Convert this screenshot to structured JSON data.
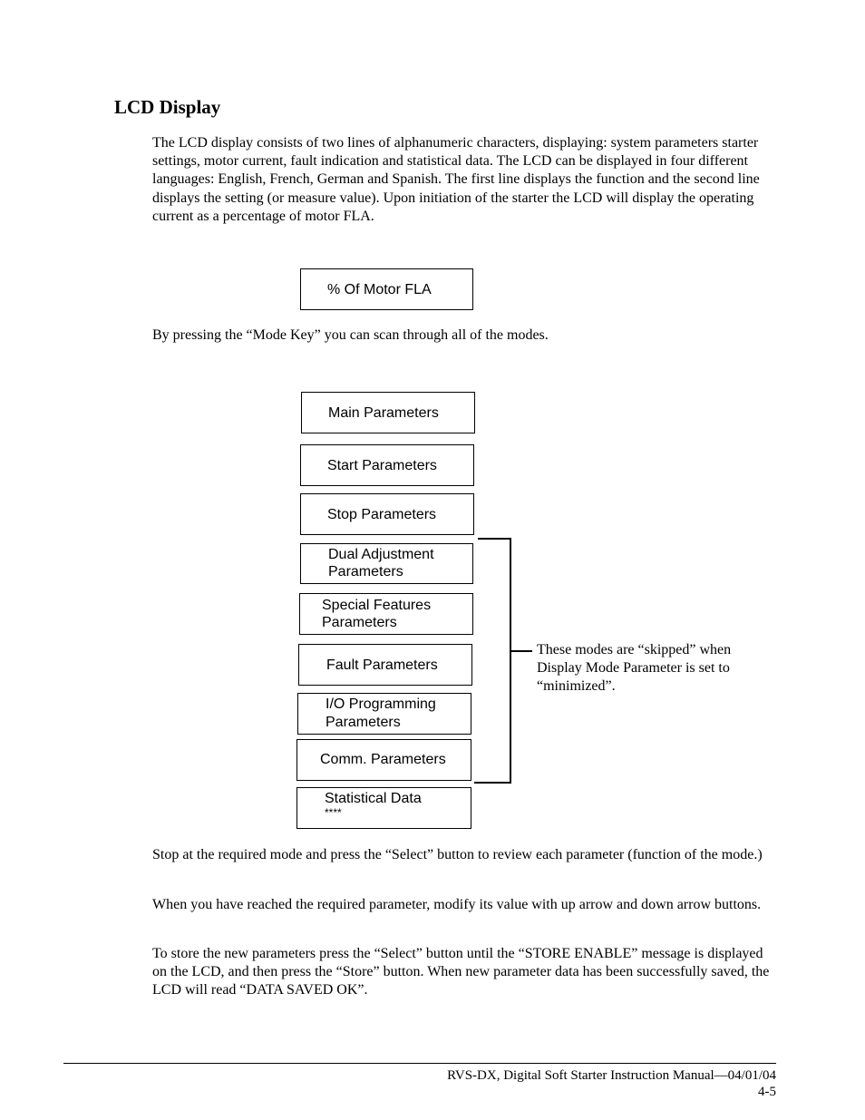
{
  "section": {
    "title": "LCD Display"
  },
  "paragraphs": {
    "intro": "The LCD display consists of two lines of alphanumeric characters, displaying: system parameters starter settings, motor current, fault indication and statistical data. The LCD can be displayed in four different languages: English, French, German and Spanish. The first line displays the function and the second line displays the setting (or measure value). Upon initiation of the starter the LCD will display the operating current as a percentage of motor FLA.",
    "mode_key": "By pressing the “Mode Key” you can scan through all of the modes.",
    "select": "Stop at the required mode and press the “Select” button to review each parameter (function of the mode.)",
    "modify": "When you have reached the required parameter, modify its value with up arrow and down arrow buttons.",
    "store": "To store the new parameters press the “Select” button until the “STORE ENABLE” message is displayed on the LCD, and then press the “Store” button. When new parameter data has been successfully saved, the LCD will read “DATA SAVED OK”."
  },
  "lcd_initial": {
    "label": "% Of Motor FLA"
  },
  "modes": [
    {
      "line1": "Main Parameters",
      "line2": ""
    },
    {
      "line1": "Start Parameters",
      "line2": ""
    },
    {
      "line1": "Stop Parameters",
      "line2": ""
    },
    {
      "line1": "Dual Adjustment",
      "line2": "Parameters"
    },
    {
      "line1": "Special Features",
      "line2": "Parameters"
    },
    {
      "line1": "Fault Parameters",
      "line2": ""
    },
    {
      "line1": "I/O Programming",
      "line2": "Parameters"
    },
    {
      "line1": "Comm. Parameters",
      "line2": ""
    },
    {
      "line1": "Statistical Data",
      "line2": "****"
    }
  ],
  "bracket_note": "These modes are “skipped” when Display Mode Parameter is set to “minimized”.",
  "footer": {
    "title": "RVS-DX, Digital Soft Starter Instruction Manual—04/01/04",
    "page": "4-5"
  }
}
